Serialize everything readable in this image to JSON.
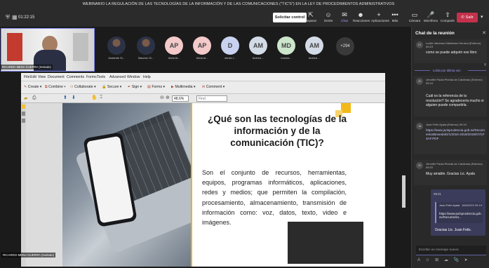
{
  "meeting": {
    "title": "WEBINARIO LA REGULACIÓN DE LAS TECNOLOGÍAS DE LA INFORMACIÓN Y DE LAS COMUNICACIONES (\"TIC'S\") EN LA LEY DE PROCEDIMIENTOS ADMINISTRATIVOS",
    "timer": "01:22:15",
    "control_btn": "Solicitar control",
    "toolbar": [
      {
        "label": "Separar",
        "icon": "⇱"
      },
      {
        "label": "Gente",
        "icon": "☺"
      },
      {
        "label": "Chat",
        "icon": "✉"
      },
      {
        "label": "Reacciones",
        "icon": "☻"
      },
      {
        "label": "Aplicaciones",
        "icon": "+"
      },
      {
        "label": "Más",
        "icon": "•••"
      },
      {
        "label": "Cámara",
        "icon": "▭"
      },
      {
        "label": "Micrófono",
        "icon": "🎤"
      },
      {
        "label": "Compartir",
        "icon": "⇧"
      }
    ],
    "leave_btn": "Salir"
  },
  "self_video": {
    "name": "RICARDO MENA GUERRA (Invitado)"
  },
  "participants": [
    {
      "initials": "",
      "name": "Asistente Si...",
      "color": "#cfd5e4"
    },
    {
      "initials": "",
      "name": "Mauricio Si...",
      "color": "#cfd5e4"
    },
    {
      "initials": "AP",
      "name": "Alicia Ar...",
      "color": "#f3c9c9"
    },
    {
      "initials": "AP",
      "name": "Alicia Ar...",
      "color": "#f3c9c9"
    },
    {
      "initials": "D",
      "name": "dorian l...",
      "color": "#c9d3f0"
    },
    {
      "initials": "AM",
      "name": "Andrea ...",
      "color": "#d3dbe6"
    },
    {
      "initials": "MD",
      "name": "mancio...",
      "color": "#cce6cc"
    },
    {
      "initials": "AM",
      "name": "Andrea ...",
      "color": "#d3dbe6"
    }
  ],
  "more_participants": "+294",
  "pdf": {
    "menu": [
      "File",
      "Edit",
      "View",
      "Document",
      "Comments",
      "Forms",
      "Tools",
      "Advanced",
      "Window",
      "Help"
    ],
    "toolbar": [
      "Create",
      "Combine",
      "Collaborate",
      "Secure",
      "Sign",
      "Forms",
      "Multimedia",
      "Comment"
    ],
    "zoom": "48.6%",
    "find": "Find"
  },
  "slide": {
    "title": "¿Qué son las tecnologías de la información y de la comunicación (TIC)?",
    "body": "Son el conjunto de recursos, herramientas, equipos, programas informáticos, aplicaciones, redes y medios; que permiten la compilación, procesamiento, almacenamiento, transmisión de información como: voz, datos, texto, video e imágenes."
  },
  "bottom_name": "RICARDO MENA GUERRA (Invitado)",
  "chat": {
    "title": "Chat de la reunión",
    "messages": [
      {
        "avatar": "LV",
        "header": "Lucila Vanessa Galdámez Herrera (Externo) 09:19",
        "body": "como se puede adquirir ese libro"
      },
      {
        "avatar": "JC",
        "header": "Jennifer Paola Pineda de Cárdenas (Externo) 09:19",
        "body": "Cuál es la referencia de la resolución? Se agradecería mucho si alguien puede compartirla."
      },
      {
        "avatar": "JA",
        "header": "Juan Felix Ayala (Externo) 09:19",
        "body": "https://www.jurisprudencia.gob.sv/DocumentosBoveda/D/1/2010-2019/2019/07/CF3AF.PDF"
      },
      {
        "avatar": "JC",
        "header": "Jennifer Paola Pineda de Cárdenas (Externo) 09:20",
        "body": "Muy amable. Gracias Lic. Ayala"
      }
    ],
    "last_read": "Leído por última vez",
    "self_msg": {
      "time": "09:21",
      "quote_author": "Juan Felix Ayala",
      "quote_time": "18/8/2022 09:19",
      "quote_text": "https://www.jurisprudencia.gob.sv/Documento...",
      "body": "Gracias Lic. Juan Felix."
    },
    "compose_placeholder": "Escribe un mensaje nuevo",
    "compose_icons": "A ☺ ⊞ ☁ 📎 ➤"
  }
}
